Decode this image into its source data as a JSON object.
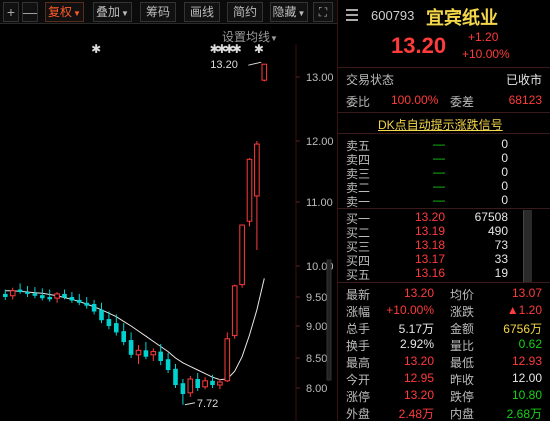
{
  "toolbar": {
    "plus": "+",
    "minus": "—",
    "fuquan": "复权",
    "diejia": "叠加",
    "choumа": "筹码",
    "huaxian": "画线",
    "jianyue": "简约",
    "yincang": "隐藏",
    "expand": "⛶"
  },
  "chart": {
    "settings_label": "设置均线",
    "y_ticks": [
      "13.00",
      "12.00",
      "11.00",
      "10.00",
      "9.50",
      "9.00",
      "8.50",
      "8.00"
    ],
    "high_label": "13.20",
    "low_label": "7.72"
  },
  "stock": {
    "code": "600793",
    "name": "宜宾纸业",
    "price": "13.20",
    "change": "+1.20",
    "change_pct": "+10.00%"
  },
  "status": {
    "label": "交易状态",
    "value": "已收市"
  },
  "ratio": {
    "webi_label": "委比",
    "webi_value": "100.00%",
    "weicha_label": "委差",
    "weicha_value": "68123"
  },
  "dk_link": "DK点自动提示涨跌信号",
  "order_book": {
    "sells": [
      {
        "label": "卖五",
        "price": "—",
        "vol": "0"
      },
      {
        "label": "卖四",
        "price": "—",
        "vol": "0"
      },
      {
        "label": "卖三",
        "price": "—",
        "vol": "0"
      },
      {
        "label": "卖二",
        "price": "—",
        "vol": "0"
      },
      {
        "label": "卖一",
        "price": "—",
        "vol": "0"
      }
    ],
    "buys": [
      {
        "label": "买一",
        "price": "13.20",
        "vol": "67508"
      },
      {
        "label": "买二",
        "price": "13.19",
        "vol": "490"
      },
      {
        "label": "买三",
        "price": "13.18",
        "vol": "73"
      },
      {
        "label": "买四",
        "price": "13.17",
        "vol": "33"
      },
      {
        "label": "买五",
        "price": "13.16",
        "vol": "19"
      }
    ]
  },
  "stats": [
    {
      "l1": "最新",
      "v1": "13.20",
      "c1": "red",
      "l2": "均价",
      "v2": "13.07",
      "c2": "red"
    },
    {
      "l1": "涨幅",
      "v1": "+10.00%",
      "c1": "red",
      "l2": "涨跌",
      "v2": "▲1.20",
      "c2": "red"
    },
    {
      "l1": "总手",
      "v1": "5.17万",
      "c1": "white",
      "l2": "金额",
      "v2": "6756万",
      "c2": "yellow"
    },
    {
      "l1": "换手",
      "v1": "2.92%",
      "c1": "white",
      "l2": "量比",
      "v2": "0.62",
      "c2": "green"
    },
    {
      "l1": "最高",
      "v1": "13.20",
      "c1": "red",
      "l2": "最低",
      "v2": "12.93",
      "c2": "red"
    },
    {
      "l1": "今开",
      "v1": "12.95",
      "c1": "red",
      "l2": "昨收",
      "v2": "12.00",
      "c2": "white"
    },
    {
      "l1": "涨停",
      "v1": "13.20",
      "c1": "red",
      "l2": "跌停",
      "v2": "10.80",
      "c2": "green"
    },
    {
      "l1": "外盘",
      "v1": "2.48万",
      "c1": "red",
      "l2": "内盘",
      "v2": "2.68万",
      "c2": "green"
    }
  ],
  "colors": {
    "up": "#ff3b3b",
    "down": "#00d2d2",
    "name": "#f5d74a",
    "background": "#000000"
  },
  "chart_data": {
    "type": "candlestick",
    "y_axis_ticks": [
      13.0,
      12.0,
      11.0,
      10.0,
      9.5,
      9.0,
      8.5,
      8.0
    ],
    "candles": [
      {
        "o": 9.55,
        "h": 9.62,
        "l": 9.45,
        "c": 9.5
      },
      {
        "o": 9.52,
        "h": 9.65,
        "l": 9.46,
        "c": 9.6
      },
      {
        "o": 9.62,
        "h": 9.72,
        "l": 9.55,
        "c": 9.58
      },
      {
        "o": 9.58,
        "h": 9.68,
        "l": 9.5,
        "c": 9.55
      },
      {
        "o": 9.56,
        "h": 9.66,
        "l": 9.48,
        "c": 9.52
      },
      {
        "o": 9.53,
        "h": 9.64,
        "l": 9.44,
        "c": 9.48
      },
      {
        "o": 9.5,
        "h": 9.62,
        "l": 9.42,
        "c": 9.46
      },
      {
        "o": 9.48,
        "h": 9.58,
        "l": 9.4,
        "c": 9.55
      },
      {
        "o": 9.55,
        "h": 9.62,
        "l": 9.46,
        "c": 9.49
      },
      {
        "o": 9.5,
        "h": 9.58,
        "l": 9.4,
        "c": 9.44
      },
      {
        "o": 9.45,
        "h": 9.55,
        "l": 9.36,
        "c": 9.4
      },
      {
        "o": 9.4,
        "h": 9.5,
        "l": 9.3,
        "c": 9.35
      },
      {
        "o": 9.38,
        "h": 9.45,
        "l": 9.2,
        "c": 9.25
      },
      {
        "o": 9.28,
        "h": 9.4,
        "l": 9.05,
        "c": 9.1
      },
      {
        "o": 9.12,
        "h": 9.25,
        "l": 8.95,
        "c": 9.0
      },
      {
        "o": 9.05,
        "h": 9.2,
        "l": 8.85,
        "c": 8.9
      },
      {
        "o": 8.92,
        "h": 9.05,
        "l": 8.7,
        "c": 8.75
      },
      {
        "o": 8.78,
        "h": 8.9,
        "l": 8.5,
        "c": 8.55
      },
      {
        "o": 8.55,
        "h": 8.7,
        "l": 8.4,
        "c": 8.62
      },
      {
        "o": 8.62,
        "h": 8.75,
        "l": 8.48,
        "c": 8.52
      },
      {
        "o": 8.55,
        "h": 8.65,
        "l": 8.45,
        "c": 8.6
      },
      {
        "o": 8.6,
        "h": 8.72,
        "l": 8.38,
        "c": 8.45
      },
      {
        "o": 8.48,
        "h": 8.58,
        "l": 8.25,
        "c": 8.3
      },
      {
        "o": 8.32,
        "h": 8.4,
        "l": 8.0,
        "c": 8.05
      },
      {
        "o": 8.08,
        "h": 8.15,
        "l": 7.72,
        "c": 7.9
      },
      {
        "o": 7.92,
        "h": 8.2,
        "l": 7.85,
        "c": 8.15
      },
      {
        "o": 8.15,
        "h": 8.25,
        "l": 7.95,
        "c": 8.0
      },
      {
        "o": 8.02,
        "h": 8.18,
        "l": 7.98,
        "c": 8.12
      },
      {
        "o": 8.12,
        "h": 8.22,
        "l": 8.0,
        "c": 8.05
      },
      {
        "o": 8.05,
        "h": 8.15,
        "l": 7.98,
        "c": 8.1
      },
      {
        "o": 8.12,
        "h": 8.9,
        "l": 8.1,
        "c": 8.8
      },
      {
        "o": 8.85,
        "h": 9.7,
        "l": 8.8,
        "c": 9.68
      },
      {
        "o": 9.7,
        "h": 10.65,
        "l": 9.65,
        "c": 10.64
      },
      {
        "o": 10.7,
        "h": 11.72,
        "l": 10.62,
        "c": 11.7
      },
      {
        "o": 11.1,
        "h": 12.0,
        "l": 10.25,
        "c": 11.95
      },
      {
        "o": 12.95,
        "h": 13.2,
        "l": 12.93,
        "c": 13.2
      }
    ],
    "ma_line": [
      9.6,
      9.6,
      9.59,
      9.58,
      9.57,
      9.56,
      9.54,
      9.52,
      9.49,
      9.46,
      9.42,
      9.38,
      9.33,
      9.28,
      9.22,
      9.16,
      9.08,
      9.0,
      8.92,
      8.84,
      8.76,
      8.68,
      8.6,
      8.5,
      8.42,
      8.36,
      8.3,
      8.24,
      8.18,
      8.14,
      8.15,
      8.28,
      8.52,
      8.86,
      9.28,
      9.8
    ],
    "star_markers_at_index": [
      12,
      28,
      29,
      30,
      31,
      34
    ]
  }
}
